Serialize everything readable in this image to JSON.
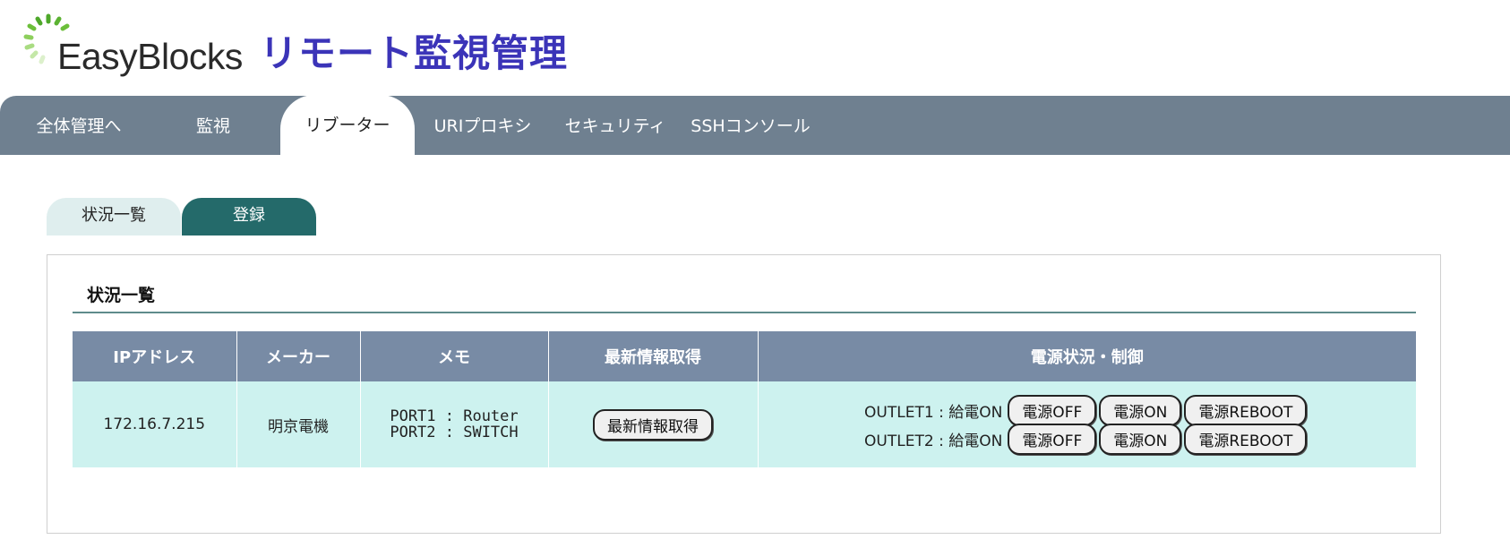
{
  "header": {
    "logo_text": "EasyBlocks",
    "app_title": "リモート監視管理",
    "colors": {
      "title": "#3b34b8",
      "logo_green": "#6cbf3a"
    }
  },
  "nav": {
    "tabs": [
      {
        "label": "全体管理へ"
      },
      {
        "label": "監視"
      },
      {
        "label": "リブーター",
        "active": true
      },
      {
        "label": "URIプロキシ"
      },
      {
        "label": "セキュリティ"
      },
      {
        "label": "SSHコンソール"
      }
    ],
    "bar_color": "#6f8090"
  },
  "subtabs": {
    "status": "状況一覧",
    "register": "登録"
  },
  "panel": {
    "title": "状況一覧",
    "table": {
      "headers": [
        "IPアドレス",
        "メーカー",
        "メモ",
        "最新情報取得",
        "電源状況・制御"
      ],
      "rows": [
        {
          "ip": "172.16.7.215",
          "maker": "明京電機",
          "memo": "PORT1 : Router\nPORT2 : SWITCH",
          "refresh_button": "最新情報取得",
          "outlets": [
            {
              "label": "OUTLET1 : 給電ON",
              "off": "電源OFF",
              "on": "電源ON",
              "reboot": "電源REBOOT"
            },
            {
              "label": "OUTLET2 : 給電ON",
              "off": "電源OFF",
              "on": "電源ON",
              "reboot": "電源REBOOT"
            }
          ]
        }
      ]
    }
  }
}
